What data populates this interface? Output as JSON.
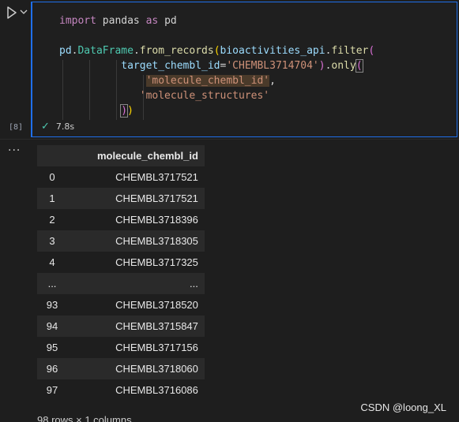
{
  "cell": {
    "exec_count": "[8]",
    "status_time": "7.8s",
    "code": {
      "l1_kw": "import",
      "l1_mod": " pandas ",
      "l1_as": "as",
      "l1_alias": " pd",
      "l3_pd": "pd",
      "l3_cls": "DataFrame",
      "l3_fn": "from_records",
      "l3_arg": "bioactivities_api",
      "l3_filter": "filter",
      "l4_kw": "target_chembl_id",
      "l4_str": "'CHEMBL3714704'",
      "l4_only": "only",
      "l5_str": "'molecule_chembl_id'",
      "l6_str": "'molecule_structures'"
    }
  },
  "output": {
    "columns": [
      "molecule_chembl_id"
    ],
    "rows": [
      {
        "index": "0",
        "value": "CHEMBL3717521"
      },
      {
        "index": "1",
        "value": "CHEMBL3717521"
      },
      {
        "index": "2",
        "value": "CHEMBL3718396"
      },
      {
        "index": "3",
        "value": "CHEMBL3718305"
      },
      {
        "index": "4",
        "value": "CHEMBL3717325"
      },
      {
        "index": "...",
        "value": "..."
      },
      {
        "index": "93",
        "value": "CHEMBL3718520"
      },
      {
        "index": "94",
        "value": "CHEMBL3715847"
      },
      {
        "index": "95",
        "value": "CHEMBL3717156"
      },
      {
        "index": "96",
        "value": "CHEMBL3718060"
      },
      {
        "index": "97",
        "value": "CHEMBL3716086"
      }
    ],
    "footer": "98 rows × 1 columns"
  },
  "watermark": "CSDN @loong_XL",
  "icons": {
    "run": "play-icon",
    "chevron": "chevron-down-icon",
    "check": "check-icon",
    "more": "more-icon"
  }
}
